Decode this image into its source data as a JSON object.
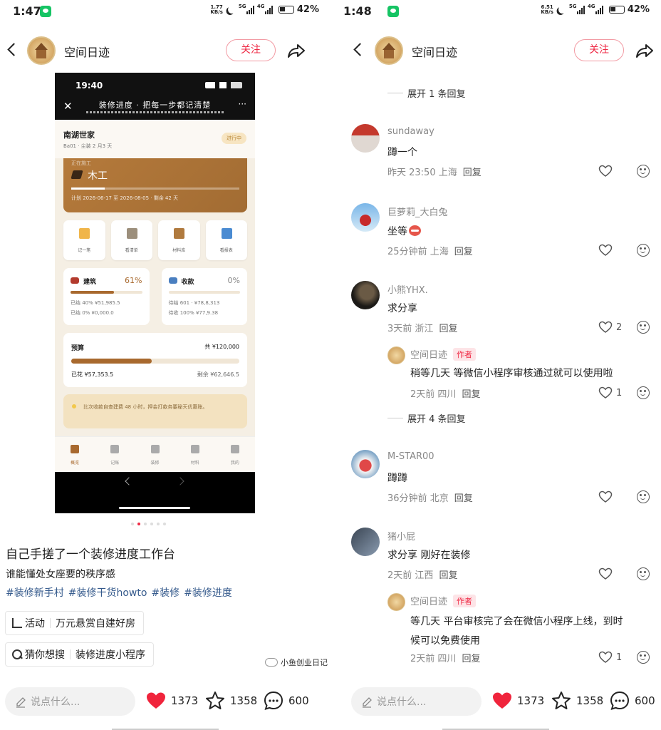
{
  "left": {
    "status": {
      "time": "1:47",
      "speed_top": "1.77",
      "speed_bot": "KB/s",
      "net1": "5G",
      "net2": "4G",
      "battery": "42%"
    },
    "header": {
      "account_name": "空间日迹",
      "follow_label": "关注"
    },
    "phone": {
      "time": "19:40",
      "title": "装修进度 · 把每一步都记清楚",
      "project_name": "南湖世家",
      "project_sub": "Ba01 · 尘装 2 月3 天",
      "badge": "进行中",
      "stage_label": "正在施工",
      "stage_name": "木工",
      "stage_progress": 0.2,
      "stage_plan": "计划 2026-06-17 至 2026-08-05 · 剩余 42 天",
      "quick": [
        {
          "label": "记一笔",
          "icon": "pencil-icon",
          "color": "#f0b54a"
        },
        {
          "label": "看清单",
          "icon": "clipboard-icon",
          "color": "#9c8f7c"
        },
        {
          "label": "材料库",
          "icon": "box-icon",
          "color": "#b07a3e"
        },
        {
          "label": "看报表",
          "icon": "chart-icon",
          "color": "#4a8bd2"
        }
      ],
      "build": {
        "title": "建筑",
        "percent_text": "61%",
        "progress": 0.61,
        "line1": "已结 40% ¥51,985.5",
        "line2": "已结 0% ¥0,000.0"
      },
      "pay": {
        "title": "收款",
        "percent_text": "0%",
        "progress": 0,
        "line1": "待结 601 · ¥78,8,313",
        "line2": "待收 100% ¥77,9.38"
      },
      "budget": {
        "title": "预算",
        "total": "共 ¥120,000",
        "spent": "已花 ¥57,353.5",
        "remain": "剩余 ¥62,646.5",
        "progress": 0.48
      },
      "tip": "比次收款自查建费 48 小时，押金打款务要秘天优惠账。",
      "tabs": [
        "概览",
        "记账",
        "装修",
        "材料",
        "我的"
      ]
    },
    "post": {
      "title": "自己手搓了一个装修进度工作台",
      "desc": "谁能懂处女座要的秩序感",
      "tags": [
        "#装修新手村",
        "#装修干货howto",
        "#装修",
        "#装修进度"
      ],
      "activity_label": "活动",
      "activity_text": "万元悬赏自建好房",
      "search_label": "猜你想搜",
      "search_text": "装修进度小程序",
      "watermark": "小鱼创业日记"
    },
    "bottom": {
      "placeholder": "说点什么...",
      "likes": "1373",
      "stars": "1358",
      "comments": "600"
    }
  },
  "right": {
    "status": {
      "time": "1:48",
      "speed_top": "6.51",
      "speed_bot": "KB/s",
      "net1": "5G",
      "net2": "4G",
      "battery": "42%"
    },
    "header": {
      "account_name": "空间日迹",
      "follow_label": "关注"
    },
    "expand1": "展开 1 条回复",
    "expand2": "展开 4 条回复",
    "comments": [
      {
        "name": "sundaway",
        "text": "蹲一个",
        "time": "昨天 23:50",
        "loc": "上海",
        "reply": "回复",
        "likes": ""
      },
      {
        "name": "巨萝莉_大白兔",
        "text": "坐等",
        "time": "25分钟前",
        "loc": "上海",
        "reply": "回复",
        "likes": ""
      },
      {
        "name": "小熊YHX.",
        "text": "求分享",
        "time": "3天前",
        "loc": "浙江",
        "reply": "回复",
        "likes": "2"
      },
      {
        "name": "空间日迹",
        "author": "作者",
        "text": "稍等几天 等微信小程序审核通过就可以使用啦",
        "time": "2天前",
        "loc": "四川",
        "reply": "回复",
        "likes": "1"
      },
      {
        "name": "M-STAR00",
        "text": "蹲蹲",
        "time": "36分钟前",
        "loc": "北京",
        "reply": "回复",
        "likes": ""
      },
      {
        "name": "猪小屁",
        "text": "求分享 刚好在装修",
        "time": "2天前",
        "loc": "江西",
        "reply": "回复",
        "likes": ""
      },
      {
        "name": "空间日迹",
        "author": "作者",
        "text_l1": "等几天 平台审核完了会在微信小程序上线，到时",
        "text_l2": "候可以免费使用",
        "time": "2天前",
        "loc": "四川",
        "reply": "回复",
        "likes": "1"
      }
    ],
    "bottom": {
      "placeholder": "说点什么...",
      "likes": "1373",
      "stars": "1358",
      "comments": "600"
    }
  }
}
